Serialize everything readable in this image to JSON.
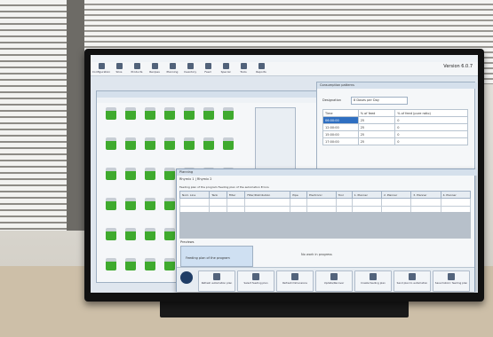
{
  "app": {
    "version": "Version 6.0.7",
    "window_title": "Consumption patterns"
  },
  "toolbar": {
    "items": [
      "Configuration",
      "Silos",
      "Products",
      "Recipes",
      "Planning",
      "Inventory",
      "Feed",
      "Special",
      "Tools",
      "Reports"
    ]
  },
  "consumption": {
    "title": "Consumption patterns",
    "designation_label": "Designation",
    "designation_value": "8 Doses per Day",
    "columns": [
      "Time",
      "% of feed",
      "% of feed (pure ratio)"
    ],
    "rows": [
      {
        "time": "06:00:00",
        "pct": "25",
        "pure": "0"
      },
      {
        "time": "12:00:00",
        "pct": "25",
        "pure": "0"
      },
      {
        "time": "15:00:00",
        "pct": "25",
        "pure": "0"
      },
      {
        "time": "17:00:00",
        "pct": "25",
        "pure": "0"
      }
    ]
  },
  "planning": {
    "title": "Planning",
    "subtitle": "Rhymix 1 | Rhymix 2",
    "menu": "Feeding plan of the program   Feeding plan of the automation   Errors",
    "columns": [
      "Nom. Line",
      "Tank",
      "Filter",
      "Filter/Distribution",
      "Pipe",
      "Electronic",
      "Tool",
      "1. Planner",
      "2. Planner",
      "3. Planner",
      "4. Planner"
    ],
    "preview_label": "Previews",
    "preview_text": "Feeding plan of the program",
    "status_text": "No work in progress",
    "buttons": [
      "Refresh automation plan",
      "Select feeding plan",
      "Refresh Dimensions",
      "Update/Recover",
      "Create feeding plan",
      "Send plan to automation",
      "Save historic feeding plan"
    ]
  },
  "colors": {
    "silo_fill": "#3faa2e",
    "accent": "#2f6fc1"
  }
}
